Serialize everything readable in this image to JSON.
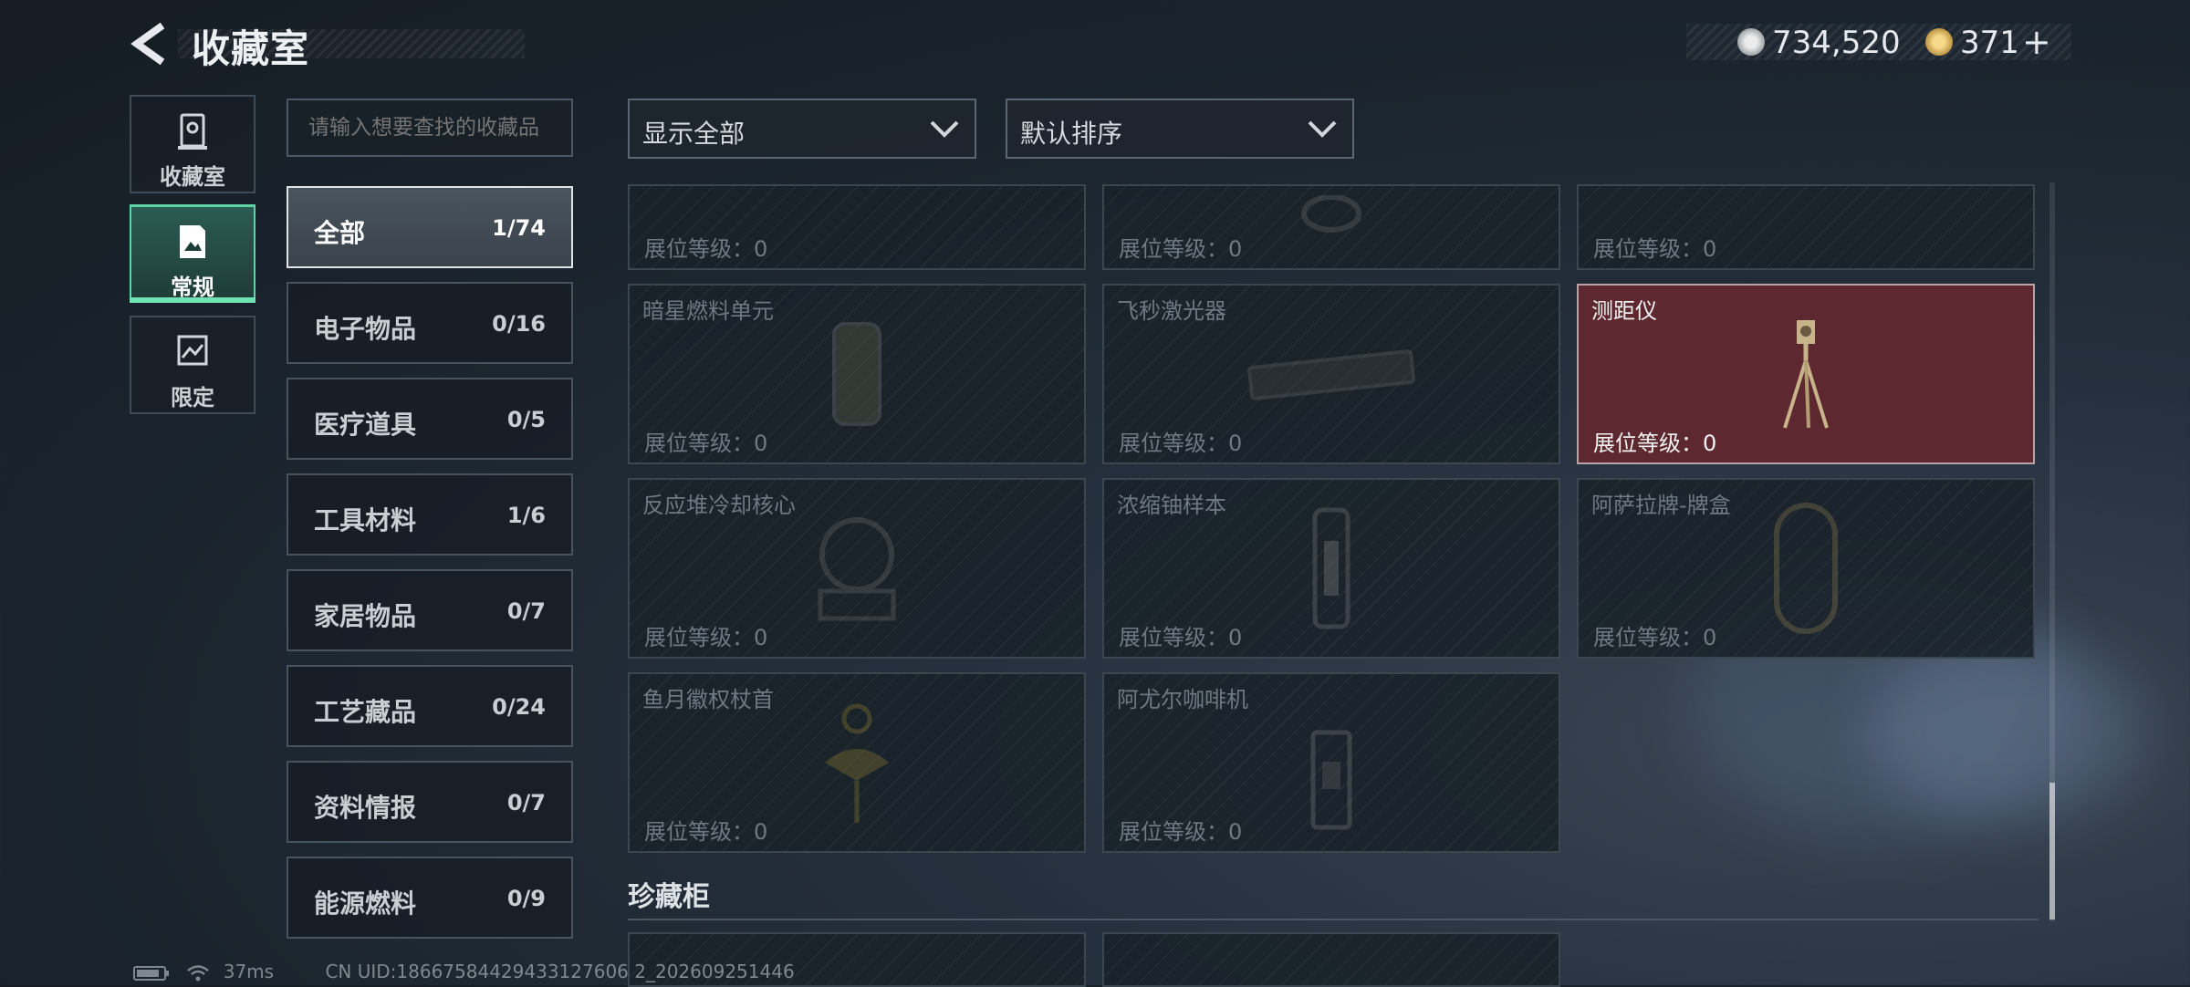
{
  "header": {
    "title": "收藏室"
  },
  "currency": {
    "coins": "734,520",
    "premium": "371",
    "premium_add": "+"
  },
  "nav": [
    {
      "label": "收藏室",
      "icon": "trophy-cabinet-icon"
    },
    {
      "label": "常规",
      "icon": "document-image-icon",
      "active": true
    },
    {
      "label": "限定",
      "icon": "picture-frame-icon"
    }
  ],
  "search": {
    "placeholder": "请输入想要查找的收藏品"
  },
  "categories": [
    {
      "label": "全部",
      "count": "1/74",
      "active": true
    },
    {
      "label": "电子物品",
      "count": "0/16"
    },
    {
      "label": "医疗道具",
      "count": "0/5"
    },
    {
      "label": "工具材料",
      "count": "1/6"
    },
    {
      "label": "家居物品",
      "count": "0/7"
    },
    {
      "label": "工艺藏品",
      "count": "0/24"
    },
    {
      "label": "资料情报",
      "count": "0/7"
    },
    {
      "label": "能源燃料",
      "count": "0/9"
    }
  ],
  "filters": {
    "show": "显示全部",
    "sort": "默认排序"
  },
  "grid": {
    "level_label": "展位等级：0",
    "items": [
      {
        "name": "",
        "owned": false
      },
      {
        "name": "",
        "owned": false
      },
      {
        "name": "",
        "owned": false
      },
      {
        "name": "暗星燃料单元",
        "owned": false
      },
      {
        "name": "飞秒激光器",
        "owned": false
      },
      {
        "name": "测距仪",
        "owned": true
      },
      {
        "name": "反应堆冷却核心",
        "owned": false
      },
      {
        "name": "浓缩铀样本",
        "owned": false
      },
      {
        "name": "阿萨拉牌-牌盒",
        "owned": false
      },
      {
        "name": "鱼月徽权杖首",
        "owned": false
      },
      {
        "name": "阿尤尔咖啡机",
        "owned": false
      }
    ]
  },
  "section": {
    "title": "珍藏柜"
  },
  "footer": {
    "ping": "37ms",
    "uid": "CN UID:18667584429433127606 2_202609251446"
  },
  "colors": {
    "accent": "#6fe3b2",
    "owned_card": "#5e2830"
  }
}
